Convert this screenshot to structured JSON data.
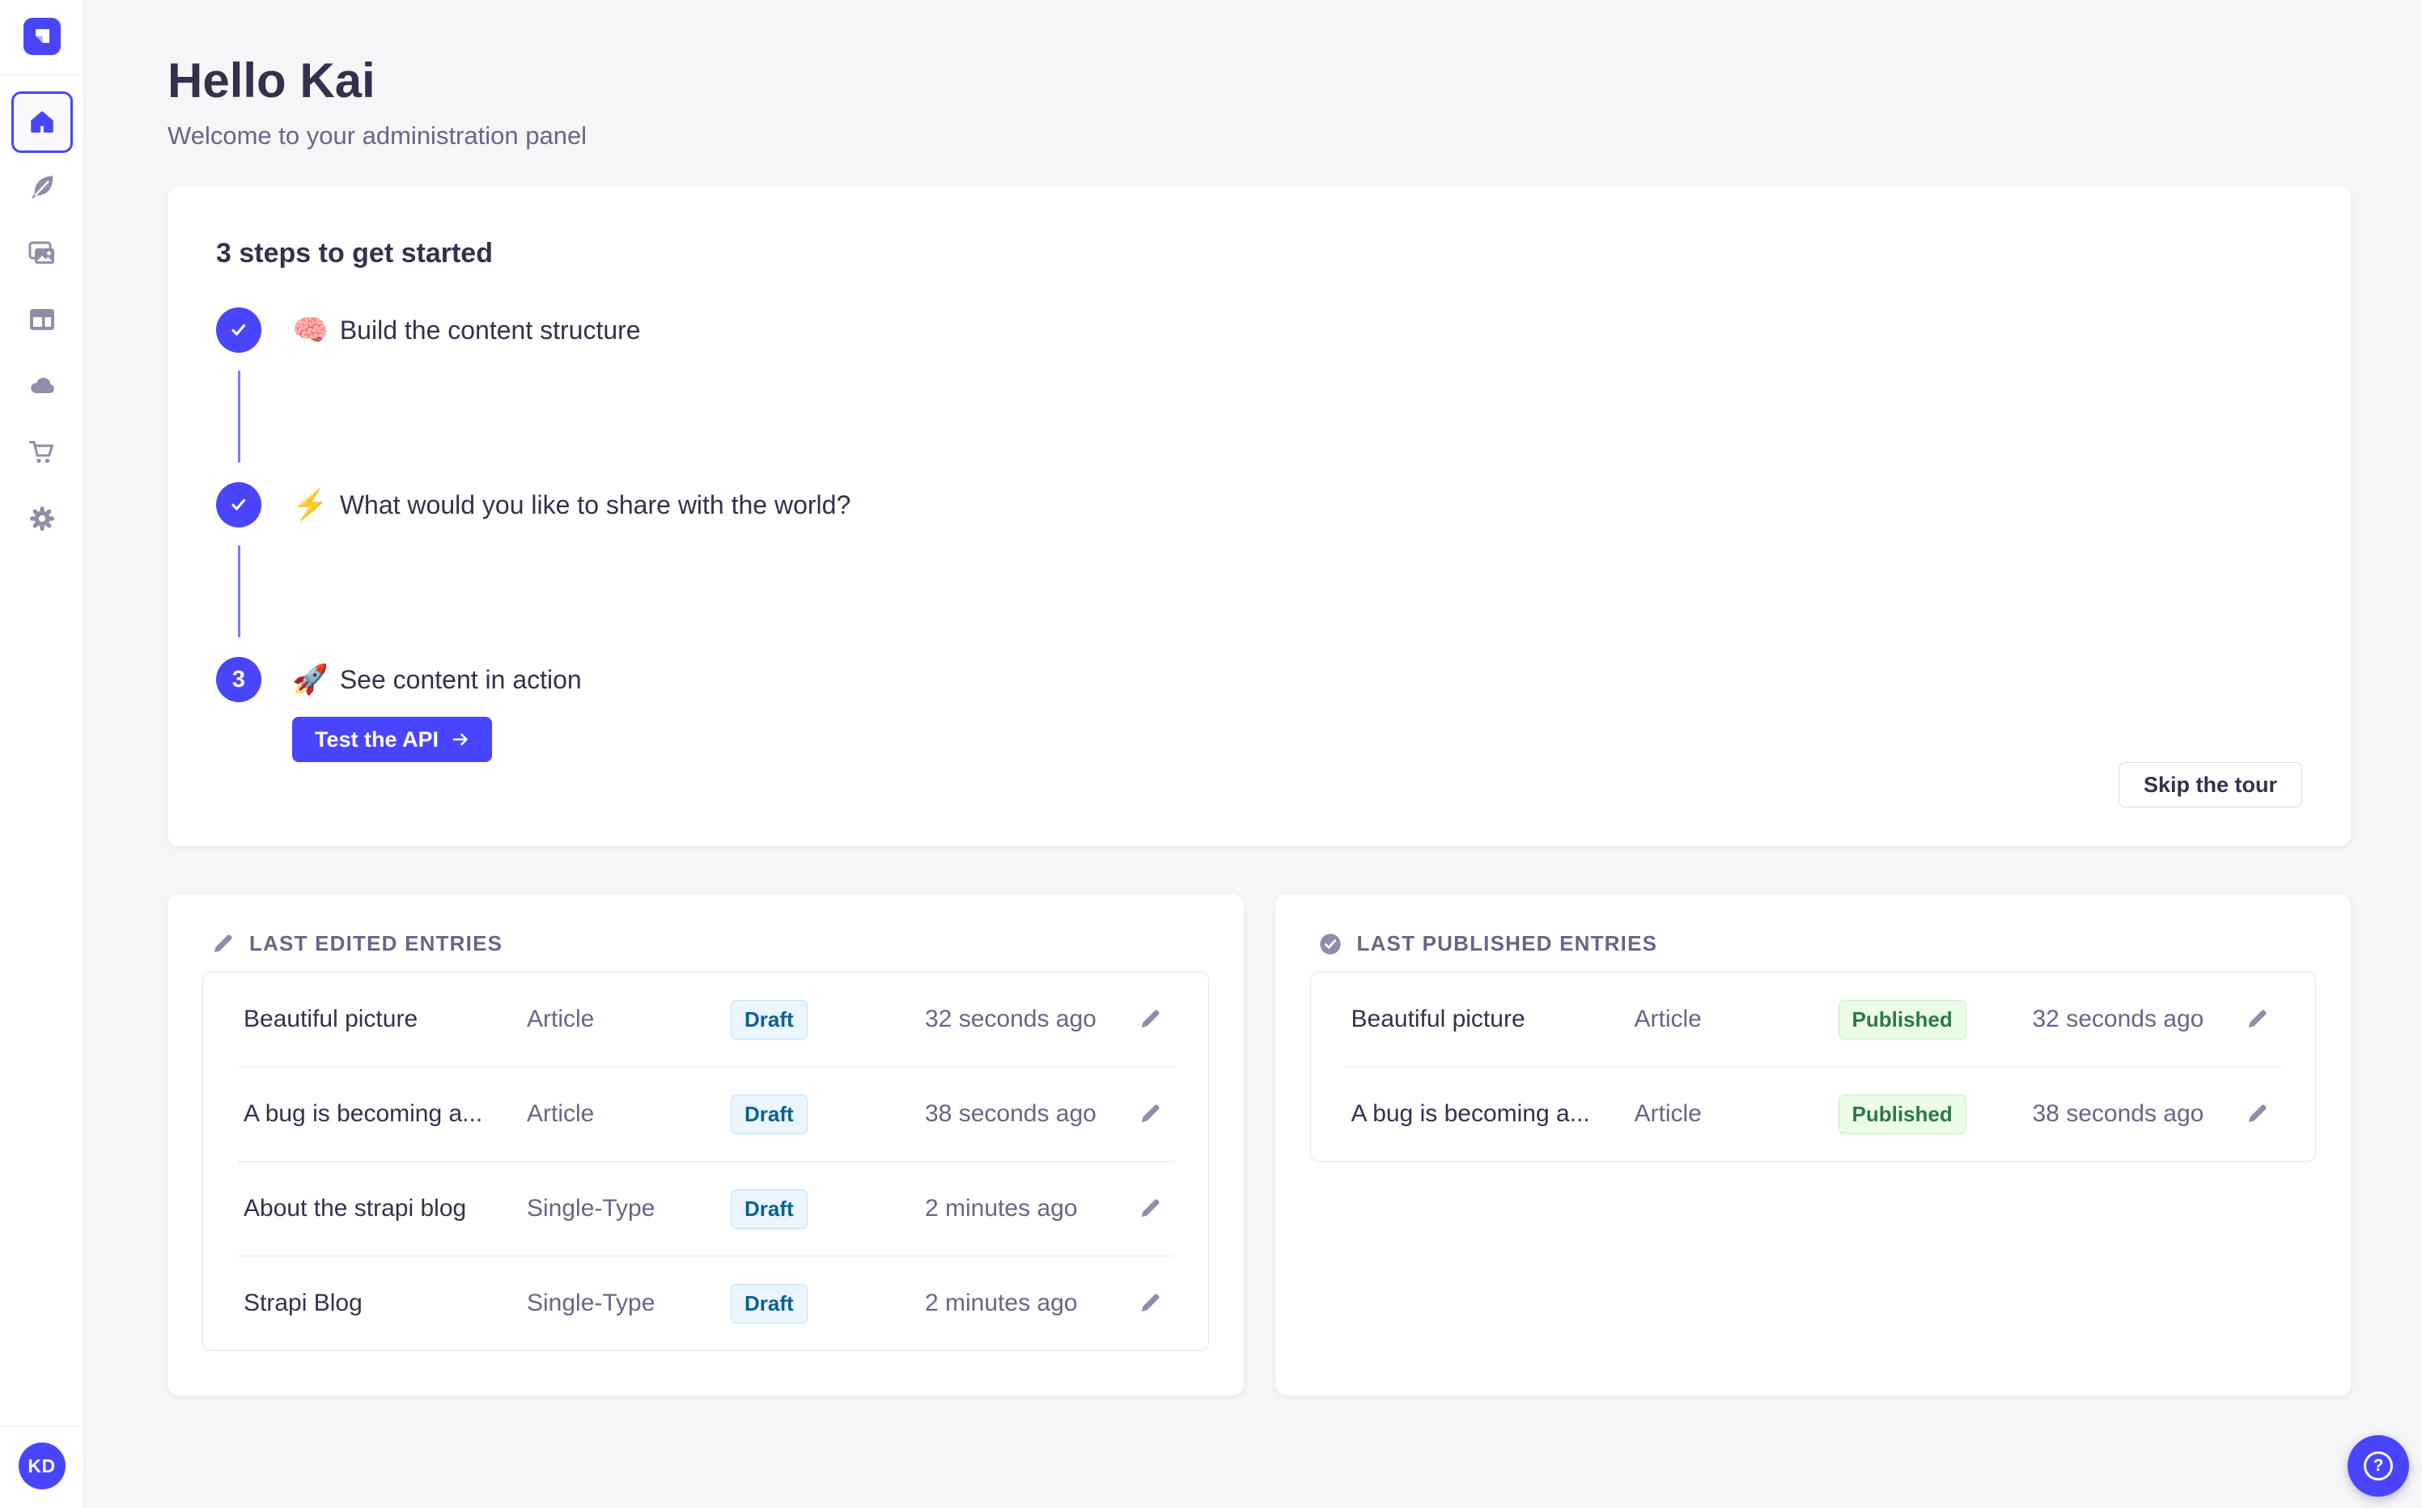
{
  "app": {
    "name": "Strapi administration panel"
  },
  "colors": {
    "primary": "#4945ff",
    "page_background": "#f6f6f9",
    "sidebar_icon": "#8e8ea9",
    "draft_text": "#0c5f94",
    "draft_background": "#eaf5ff",
    "draft_border": "#b8e1ff",
    "published_text": "#2f7846",
    "published_background": "#eafbe7",
    "published_border": "#c9efc4"
  },
  "sidebar": {
    "icons": [
      "strapi-logo",
      "home",
      "feather",
      "pictures",
      "layout",
      "cloud",
      "cart",
      "gear"
    ],
    "active_item": "home",
    "avatar_initials": "KD"
  },
  "header": {
    "title": "Hello Kai",
    "subtitle": "Welcome to your administration panel"
  },
  "onboarding": {
    "title": "3 steps to get started",
    "steps": [
      {
        "status": "completed",
        "emoji": "🧠",
        "label": "Build the content structure"
      },
      {
        "status": "completed",
        "emoji": "⚡",
        "label": "What would you like to share with the world?"
      },
      {
        "status": "current",
        "number": "3",
        "emoji": "🚀",
        "label": "See content in action",
        "cta_label": "Test the API"
      }
    ],
    "skip_label": "Skip the tour"
  },
  "last_edited": {
    "title": "LAST EDITED ENTRIES",
    "rows": [
      {
        "name": "Beautiful picture",
        "type": "Article",
        "status": "Draft",
        "time": "32 seconds ago"
      },
      {
        "name": "A bug is becoming a...",
        "type": "Article",
        "status": "Draft",
        "time": "38 seconds ago"
      },
      {
        "name": "About the strapi blog",
        "type": "Single-Type",
        "status": "Draft",
        "time": "2 minutes ago"
      },
      {
        "name": "Strapi Blog",
        "type": "Single-Type",
        "status": "Draft",
        "time": "2 minutes ago"
      }
    ]
  },
  "last_published": {
    "title": "LAST PUBLISHED ENTRIES",
    "rows": [
      {
        "name": "Beautiful picture",
        "type": "Article",
        "status": "Published",
        "time": "32 seconds ago"
      },
      {
        "name": "A bug is becoming a...",
        "type": "Article",
        "status": "Published",
        "time": "38 seconds ago"
      }
    ]
  },
  "help": {
    "glyph": "?"
  }
}
